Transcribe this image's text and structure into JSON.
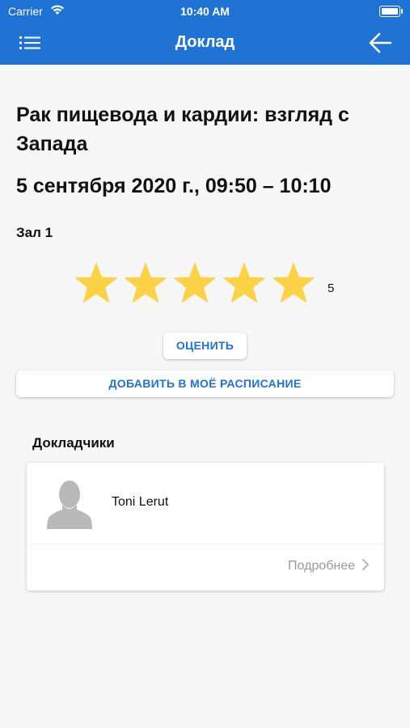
{
  "status_bar": {
    "carrier": "Carrier",
    "time": "10:40 AM"
  },
  "nav": {
    "title": "Доклад",
    "menu_icon": "hamburger-menu-icon",
    "back_icon": "arrow-left-icon"
  },
  "talk": {
    "title": "Рак пищевода и кардии: взгляд с Запада",
    "datetime": "5 сентября 2020 г., 09:50 – 10:10",
    "hall": "Зал 1",
    "rating": 5,
    "rating_max": 5,
    "rating_label": "5"
  },
  "actions": {
    "rate_label": "ОЦЕНИТЬ",
    "add_label": "ДОБАВИТЬ В МОЁ РАСПИСАНИЕ"
  },
  "speakers": {
    "heading": "Докладчики",
    "items": [
      {
        "name": "Toni Lerut",
        "more_label": "Подробнее"
      }
    ]
  },
  "colors": {
    "brand": "#1f73d4",
    "star": "#fcd247",
    "background": "#f7f7f7"
  }
}
